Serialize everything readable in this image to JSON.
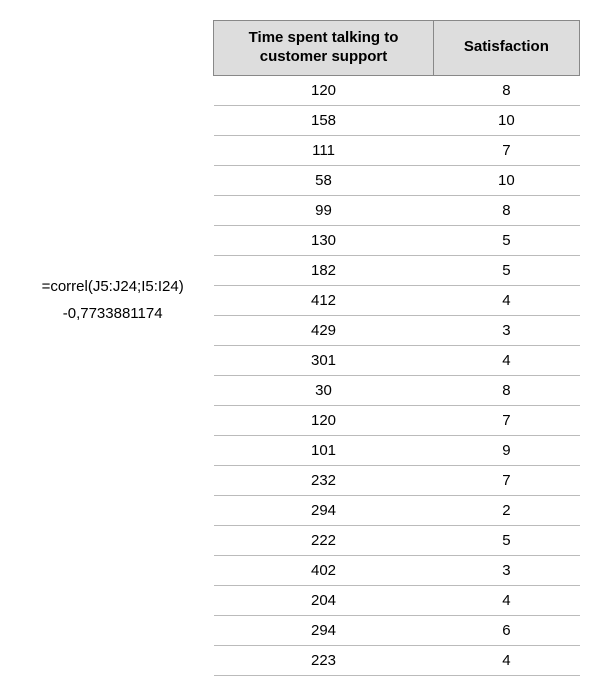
{
  "left": {
    "formula": "=correl(J5:J24;I5:I24)",
    "result": "-0,7733881174"
  },
  "table": {
    "headers": {
      "col1": "Time spent talking to customer support",
      "col2": "Satisfaction"
    },
    "rows": [
      {
        "time": "120",
        "sat": "8"
      },
      {
        "time": "158",
        "sat": "10"
      },
      {
        "time": "111",
        "sat": "7"
      },
      {
        "time": "58",
        "sat": "10"
      },
      {
        "time": "99",
        "sat": "8"
      },
      {
        "time": "130",
        "sat": "5"
      },
      {
        "time": "182",
        "sat": "5"
      },
      {
        "time": "412",
        "sat": "4"
      },
      {
        "time": "429",
        "sat": "3"
      },
      {
        "time": "301",
        "sat": "4"
      },
      {
        "time": "30",
        "sat": "8"
      },
      {
        "time": "120",
        "sat": "7"
      },
      {
        "time": "101",
        "sat": "9"
      },
      {
        "time": "232",
        "sat": "7"
      },
      {
        "time": "294",
        "sat": "2"
      },
      {
        "time": "222",
        "sat": "5"
      },
      {
        "time": "402",
        "sat": "3"
      },
      {
        "time": "204",
        "sat": "4"
      },
      {
        "time": "294",
        "sat": "6"
      },
      {
        "time": "223",
        "sat": "4"
      }
    ]
  }
}
